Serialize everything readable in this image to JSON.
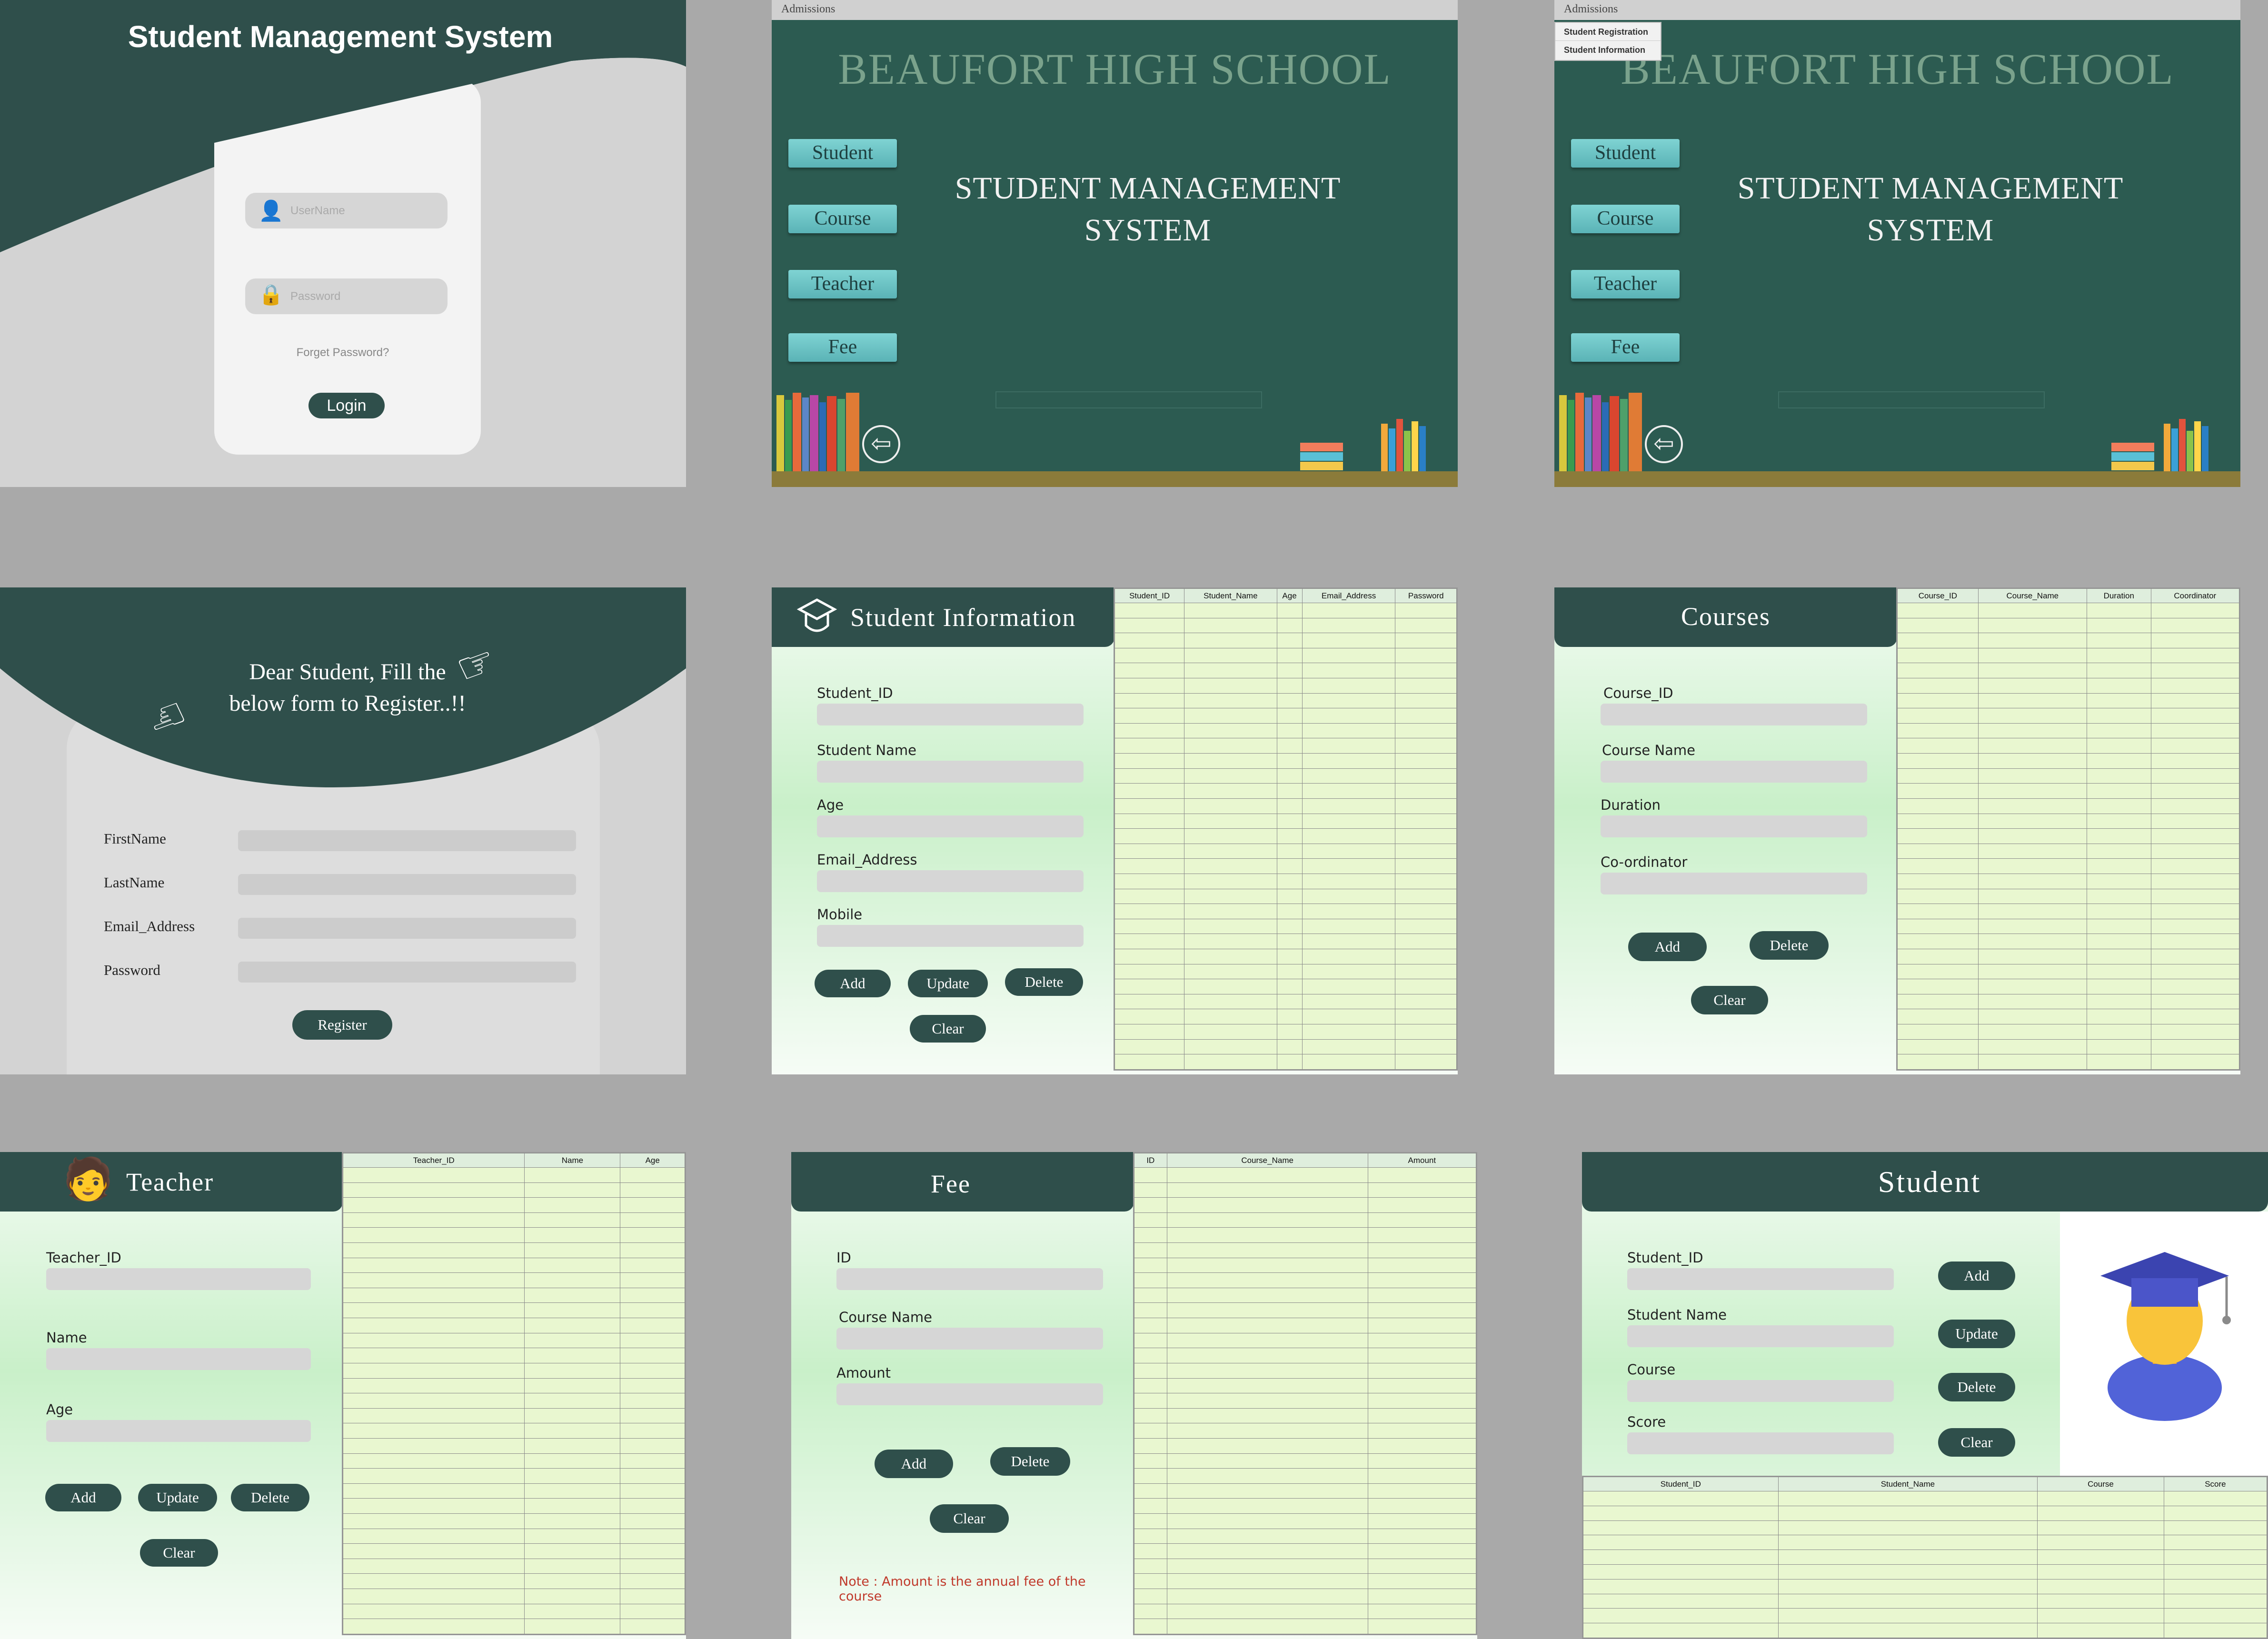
{
  "login": {
    "title": "Student Management System",
    "username_placeholder": "UserName",
    "password_placeholder": "Password",
    "forgot": "Forget Password?",
    "login": "Login"
  },
  "home": {
    "menu": "Admissions",
    "school": "BEAUFORT HIGH SCHOOL",
    "sms_line1": "STUDENT MANAGEMENT",
    "sms_line2": "SYSTEM",
    "buttons": [
      "Student",
      "Course",
      "Teacher",
      "Fee"
    ],
    "dropdown": [
      "Student Registration",
      "Student Information"
    ]
  },
  "register": {
    "greeting_line1": "Dear Student, Fill the",
    "greeting_line2": "below form to Register..!!",
    "labels": [
      "FirstName",
      "LastName",
      "Email_Address",
      "Password"
    ],
    "button": "Register"
  },
  "student_info": {
    "title": "Student Information",
    "labels": [
      "Student_ID",
      "Student Name",
      "Age",
      "Email_Address",
      "Mobile"
    ],
    "buttons": {
      "add": "Add",
      "update": "Update",
      "delete": "Delete",
      "clear": "Clear"
    },
    "columns": [
      "Student_ID",
      "Student_Name",
      "Age",
      "Email_Address",
      "Password"
    ]
  },
  "courses": {
    "title": "Courses",
    "labels": [
      "Course_ID",
      "Course Name",
      "Duration",
      "Co-ordinator"
    ],
    "buttons": {
      "add": "Add",
      "delete": "Delete",
      "clear": "Clear"
    },
    "columns": [
      "Course_ID",
      "Course_Name",
      "Duration",
      "Coordinator"
    ]
  },
  "teacher": {
    "title": "Teacher",
    "labels": [
      "Teacher_ID",
      "Name",
      "Age"
    ],
    "buttons": {
      "add": "Add",
      "update": "Update",
      "delete": "Delete",
      "clear": "Clear"
    },
    "columns": [
      "Teacher_ID",
      "Name",
      "Age"
    ]
  },
  "fee": {
    "title": "Fee",
    "labels": [
      "ID",
      "Course Name",
      "Amount"
    ],
    "buttons": {
      "add": "Add",
      "delete": "Delete",
      "clear": "Clear"
    },
    "columns": [
      "ID",
      "Course_Name",
      "Amount"
    ],
    "note_line1": "Note : Amount is the annual fee of the",
    "note_line2": "course"
  },
  "student": {
    "title": "Student",
    "labels": [
      "Student_ID",
      "Student Name",
      "Course",
      "Score"
    ],
    "buttons": {
      "add": "Add",
      "update": "Update",
      "delete": "Delete",
      "clear": "Clear"
    },
    "columns": [
      "Student_ID",
      "Student_Name",
      "Course",
      "Score"
    ]
  },
  "colors": {
    "header": "#2f4f4b",
    "board": "#2c5b51",
    "grid": "#e9f7d0",
    "note": "#c0392b"
  }
}
